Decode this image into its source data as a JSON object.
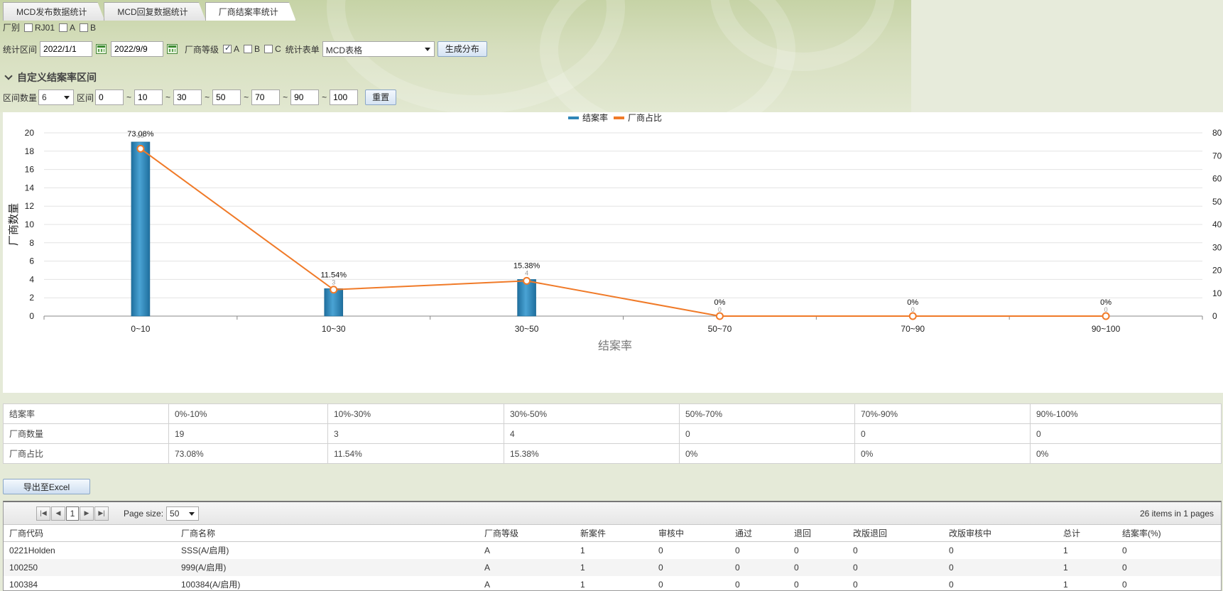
{
  "tabs": [
    "MCD发布数据统计",
    "MCD回复数据统计",
    "厂商结案率统计"
  ],
  "filters": {
    "vendor_label": "厂别",
    "vendor_options": [
      {
        "label": "RJ01",
        "checked": false
      },
      {
        "label": "A",
        "checked": false
      },
      {
        "label": "B",
        "checked": false
      }
    ],
    "period_label": "统计区间",
    "date_from": "2022/1/1",
    "date_to": "2022/9/9",
    "grade_label": "厂商等级",
    "grade_options": [
      {
        "label": "A",
        "checked": true
      },
      {
        "label": "B",
        "checked": false
      },
      {
        "label": "C",
        "checked": false
      }
    ],
    "form_label": "统计表单",
    "form_value": "MCD表格",
    "generate_label": "生成分布"
  },
  "custom": {
    "title": "自定义结案率区间",
    "count_label": "区间数量",
    "count_value": "6",
    "range_label": "区间",
    "range_values": [
      "0",
      "10",
      "30",
      "50",
      "70",
      "90",
      "100"
    ],
    "range_sep": "~",
    "reset_label": "重置"
  },
  "chart_data": {
    "type": "bar",
    "categories": [
      "0~10",
      "10~30",
      "30~50",
      "50~70",
      "70~90",
      "90~100"
    ],
    "series": [
      {
        "name": "结案率",
        "type": "bar",
        "axis": "left",
        "values": [
          19,
          3,
          4,
          0,
          0,
          0
        ],
        "color": "#2f86b8"
      },
      {
        "name": "厂商占比",
        "type": "line",
        "axis": "right",
        "values": [
          73.08,
          11.54,
          15.38,
          0,
          0,
          0
        ],
        "labels": [
          "73.08%",
          "11.54%",
          "15.38%",
          "0%",
          "0%",
          "0%"
        ],
        "color": "#f07a28"
      }
    ],
    "bar_labels": [
      "19",
      "3",
      "4",
      "0",
      "0",
      "0"
    ],
    "xlabel": "结案率",
    "ylabel": "厂商数量",
    "ylim": [
      0,
      20
    ],
    "yticks": [
      "0",
      "2",
      "4",
      "6",
      "8",
      "10",
      "12",
      "14",
      "16",
      "18",
      "20"
    ],
    "y2lim": [
      0,
      80
    ],
    "y2ticks": [
      "0",
      "10",
      "20",
      "30",
      "40",
      "50",
      "60",
      "70",
      "80"
    ],
    "legend": "top-center",
    "grid": true
  },
  "summary": {
    "rows": [
      [
        "结案率",
        "0%-10%",
        "10%-30%",
        "30%-50%",
        "50%-70%",
        "70%-90%",
        "90%-100%"
      ],
      [
        "厂商数量",
        "19",
        "3",
        "4",
        "0",
        "0",
        "0"
      ],
      [
        "厂商占比",
        "73.08%",
        "11.54%",
        "15.38%",
        "0%",
        "0%",
        "0%"
      ]
    ]
  },
  "export_label": "导出至Excel",
  "pager": {
    "page": "1",
    "page_size_label": "Page size:",
    "page_size": "50",
    "info": "26 items in 1 pages"
  },
  "grid": {
    "columns": [
      "厂商代码",
      "厂商名称",
      "厂商等级",
      "新案件",
      "审核中",
      "通过",
      "退回",
      "改版退回",
      "改版审核中",
      "总计",
      "结案率(%)"
    ],
    "rows": [
      [
        "0221Holden",
        "SSS(A/启用)",
        "A",
        "1",
        "0",
        "0",
        "0",
        "0",
        "0",
        "1",
        "0"
      ],
      [
        "100250",
        "999(A/启用)",
        "A",
        "1",
        "0",
        "0",
        "0",
        "0",
        "0",
        "1",
        "0"
      ],
      [
        "100384",
        "100384(A/启用)",
        "A",
        "1",
        "0",
        "0",
        "0",
        "0",
        "0",
        "1",
        "0"
      ]
    ]
  }
}
